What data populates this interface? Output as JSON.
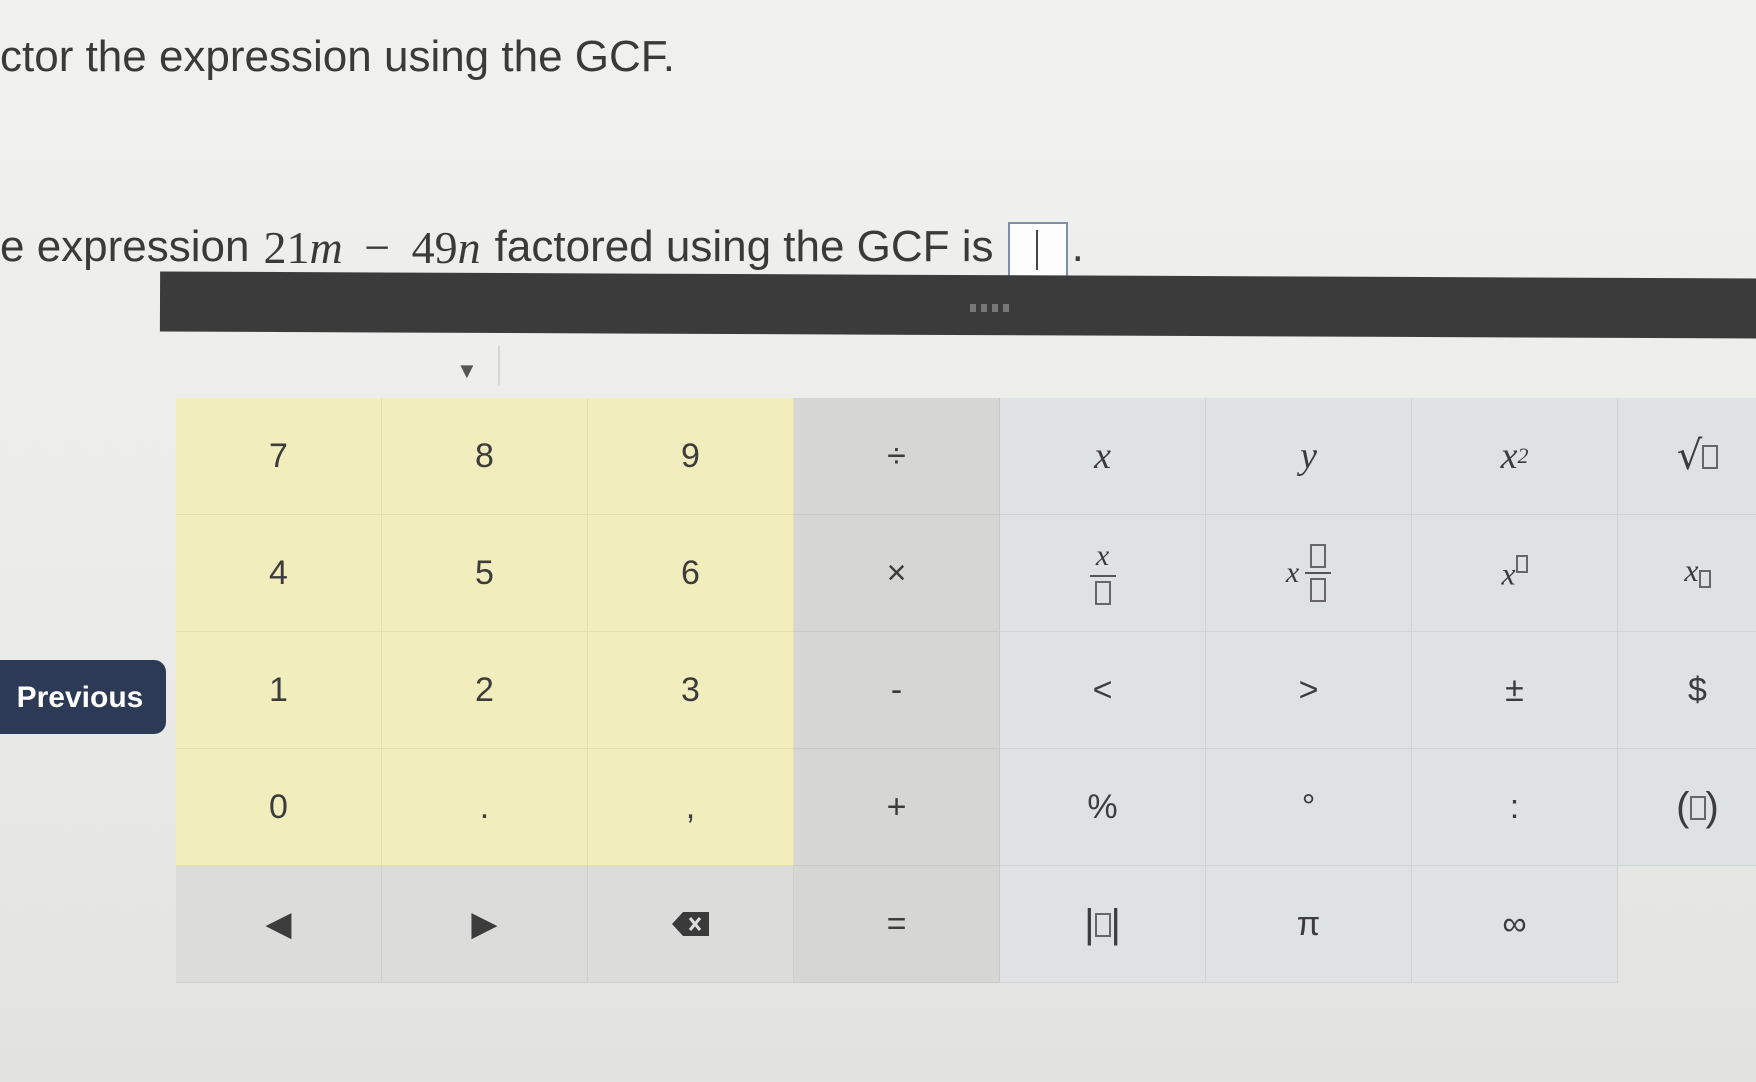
{
  "question": {
    "title": "ctor the expression using the GCF.",
    "prompt_start": "e expression",
    "expr_a": "21",
    "var_a": "m",
    "minus": "−",
    "expr_b": "49",
    "var_b": "n",
    "prompt_end": "factored using the GCF is",
    "end_period": "."
  },
  "navigation": {
    "previous_label": "Previous"
  },
  "keypad": {
    "numbers": [
      "7",
      "8",
      "9",
      "4",
      "5",
      "6",
      "1",
      "2",
      "3",
      "0",
      ".",
      ","
    ],
    "ops": {
      "divide": "÷",
      "multiply": "×",
      "minus": "-",
      "plus": "+",
      "equals": "="
    },
    "symbols": {
      "x": "x",
      "y": "y",
      "x_sq_base": "x",
      "x_sq_exp": "2",
      "frac_top": "x",
      "mixed_x": "x",
      "power_base": "x",
      "sub_base": "x",
      "lt": "<",
      "gt": ">",
      "plusminus": "±",
      "dollar": "$",
      "percent": "%",
      "degree": "°",
      "colon": ":",
      "pi": "π",
      "infinity": "∞"
    }
  },
  "colors": {
    "number_keys": "#f2edbd",
    "symbol_keys": "#dfe2e3",
    "ops_keys": "#d6d6d4",
    "toolbar": "#3b3b3b",
    "previous_button": "#2c3a55"
  }
}
